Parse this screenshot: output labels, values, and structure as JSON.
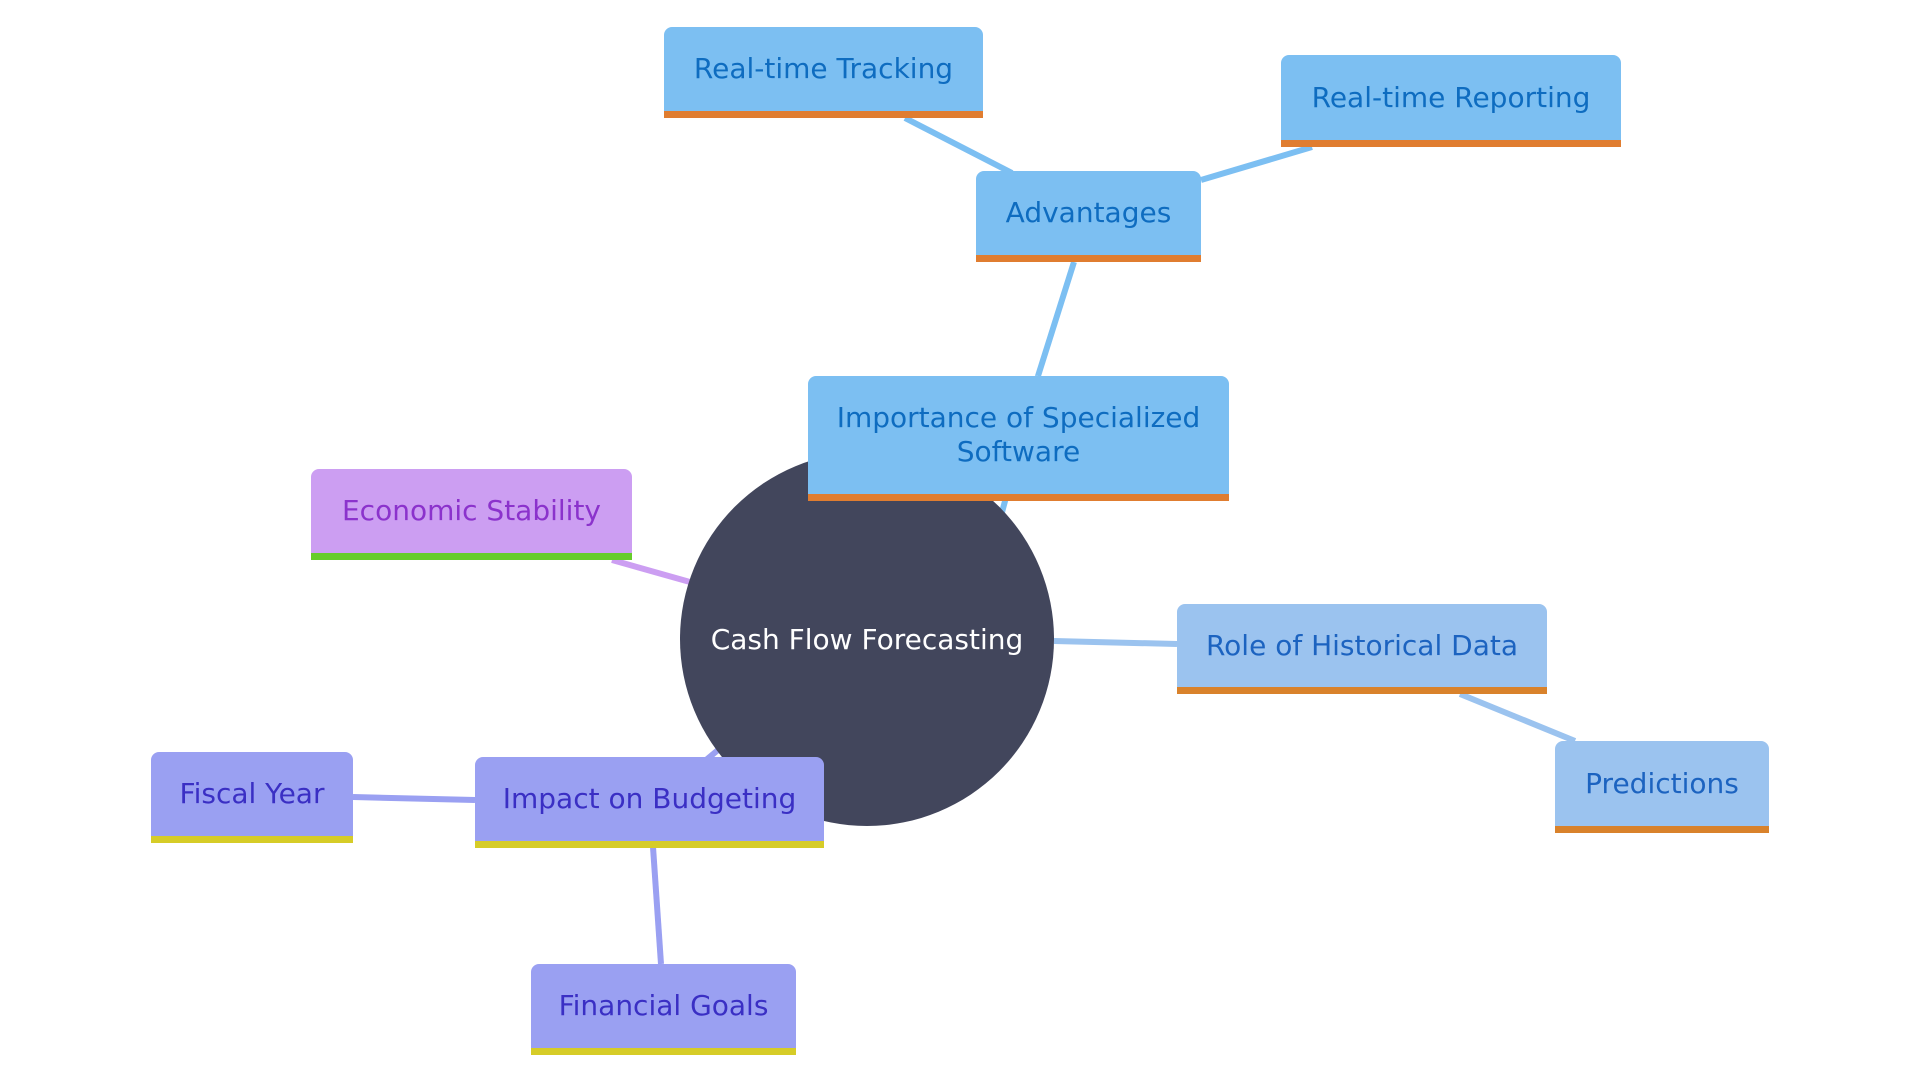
{
  "diagram": {
    "type": "mindmap",
    "root": {
      "label": "Cash Flow Forecasting"
    },
    "nodes": {
      "importance": {
        "label": "Importance of Specialized Software"
      },
      "advantages": {
        "label": "Advantages"
      },
      "tracking": {
        "label": "Real-time Tracking"
      },
      "reporting": {
        "label": "Real-time Reporting"
      },
      "economic": {
        "label": "Economic Stability"
      },
      "historical": {
        "label": "Role of Historical Data"
      },
      "predictions": {
        "label": "Predictions"
      },
      "budgeting": {
        "label": "Impact on Budgeting"
      },
      "fiscal": {
        "label": "Fiscal Year"
      },
      "goals": {
        "label": "Financial Goals"
      }
    },
    "edges": [
      {
        "from": "root",
        "to": "importance"
      },
      {
        "from": "importance",
        "to": "advantages"
      },
      {
        "from": "advantages",
        "to": "tracking"
      },
      {
        "from": "advantages",
        "to": "reporting"
      },
      {
        "from": "root",
        "to": "economic"
      },
      {
        "from": "root",
        "to": "historical"
      },
      {
        "from": "historical",
        "to": "predictions"
      },
      {
        "from": "root",
        "to": "budgeting"
      },
      {
        "from": "budgeting",
        "to": "fiscal"
      },
      {
        "from": "budgeting",
        "to": "goals"
      }
    ],
    "colors": {
      "root": "#42465c",
      "software_branch": "#7cbff2",
      "historical_branch": "#9bc3ef",
      "economic_branch": "#cc9ef2",
      "budgeting_branch": "#9aa0f2",
      "orange_underline": "#e07d30",
      "green_underline": "#66cc2a",
      "yellow_underline": "#d6cc28"
    }
  }
}
